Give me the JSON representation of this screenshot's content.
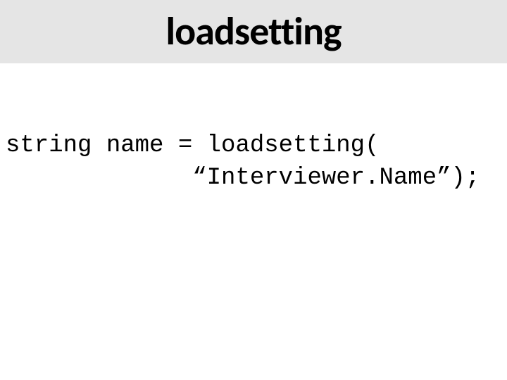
{
  "title": "loadsetting",
  "code": {
    "line1": "string name = loadsetting(",
    "line2": "             “Interviewer.Name”);"
  }
}
